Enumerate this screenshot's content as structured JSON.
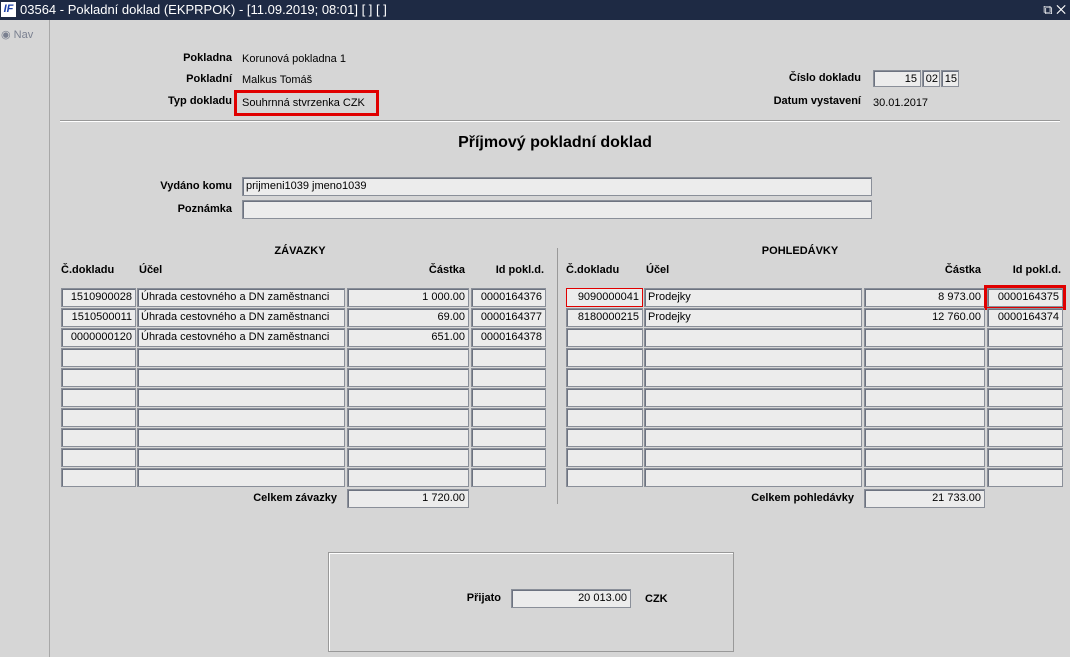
{
  "window": {
    "title": "03564 - Pokladní doklad (EKPRPOK) - [11.09.2019; 08:01]  [ ]  [ ]",
    "logo": "IF",
    "controls": "⧉ ✕"
  },
  "nav": {
    "label": "Nav"
  },
  "header": {
    "pokladna_label": "Pokladna",
    "pokladna": "Korunová pokladna 1",
    "pokladni_label": "Pokladní",
    "pokladni": "Malkus Tomáš",
    "typ_label": "Typ dokladu",
    "typ": "Souhrnná stvrzenka CZK",
    "cislo_label": "Číslo dokladu",
    "cislo": [
      "15",
      "02",
      "15"
    ],
    "datum_label": "Datum vystavení",
    "datum": "30.01.2017"
  },
  "doc_title": "Příjmový pokladní doklad",
  "vydano_label": "Vydáno komu",
  "vydano": "prijmeni1039 jmeno1039",
  "poznamka_label": "Poznámka",
  "poznamka": "",
  "columns": {
    "doc": "Č.dokladu",
    "ucel": "Účel",
    "castka": "Částka",
    "id": "Id pokl.d."
  },
  "zavazky": {
    "title": "ZÁVAZKY",
    "rows": [
      {
        "doc": "1510900028",
        "ucel": "Úhrada cestovného a DN zaměstnanci",
        "castka": "1 000.00",
        "id": "0000164376"
      },
      {
        "doc": "1510500011",
        "ucel": "Úhrada cestovného a DN zaměstnanci",
        "castka": "69.00",
        "id": "0000164377"
      },
      {
        "doc": "0000000120",
        "ucel": "Úhrada cestovného a DN zaměstnanci",
        "castka": "651.00",
        "id": "0000164378"
      }
    ],
    "total_label": "Celkem závazky",
    "total": "1 720.00"
  },
  "pohledavky": {
    "title": "POHLEDÁVKY",
    "rows": [
      {
        "doc": "9090000041",
        "ucel": "Prodejky",
        "castka": "8 973.00",
        "id": "0000164375"
      },
      {
        "doc": "8180000215",
        "ucel": "Prodejky",
        "castka": "12 760.00",
        "id": "0000164374"
      }
    ],
    "total_label": "Celkem pohledávky",
    "total": "21 733.00"
  },
  "prijato": {
    "label": "Přijato",
    "value": "20 013.00",
    "currency": "CZK"
  }
}
